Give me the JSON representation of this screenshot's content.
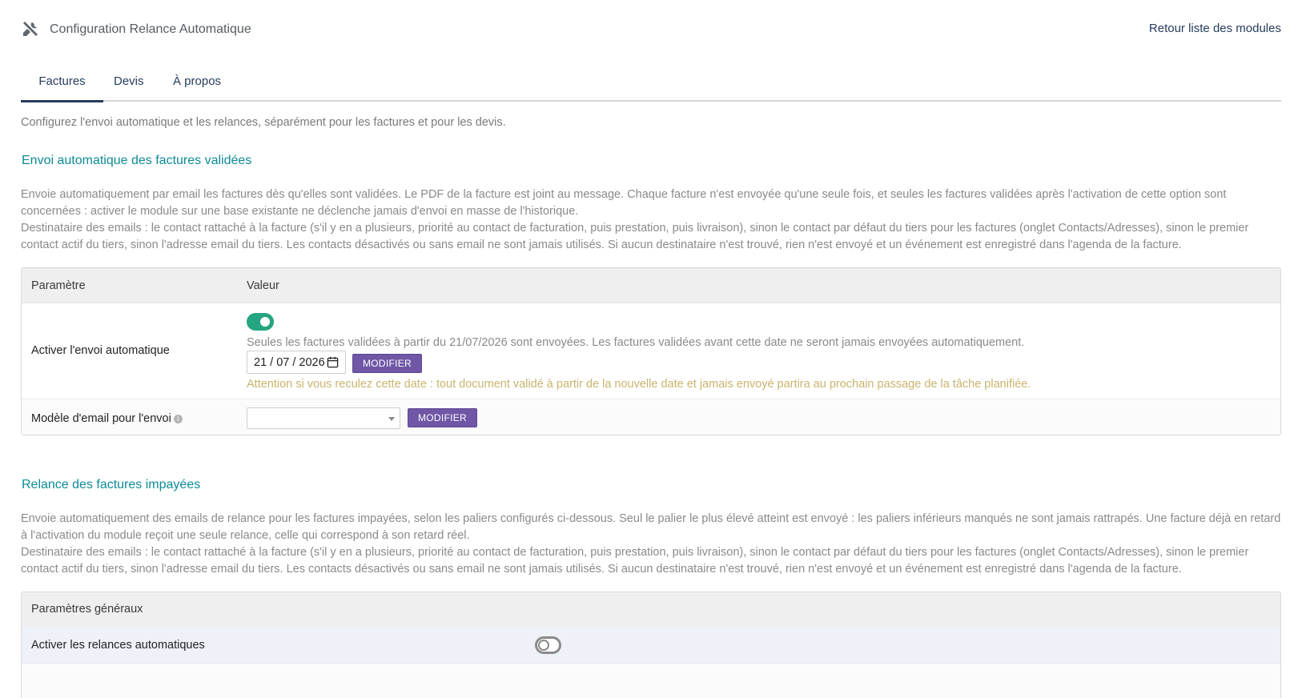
{
  "header": {
    "title": "Configuration Relance Automatique",
    "back_link": "Retour liste des modules"
  },
  "tabs": [
    {
      "label": "Factures",
      "active": true
    },
    {
      "label": "Devis",
      "active": false
    },
    {
      "label": "À propos",
      "active": false
    }
  ],
  "intro": "Configurez l'envoi automatique et les relances, séparément pour les factures et pour les devis.",
  "section_auto": {
    "title": "Envoi automatique des factures validées",
    "desc_1": "Envoie automatiquement par email les factures dès qu'elles sont validées. Le PDF de la facture est joint au message. Chaque facture n'est envoyée qu'une seule fois, et seules les factures validées après l'activation de cette option sont concernées : activer le module sur une base existante ne déclenche jamais d'envoi en masse de l'historique.",
    "desc_2": "Destinataire des emails : le contact rattaché à la facture (s'il y en a plusieurs, priorité au contact de facturation, puis prestation, puis livraison), sinon le contact par défaut du tiers pour les factures (onglet Contacts/Adresses), sinon le premier contact actif du tiers, sinon l'adresse email du tiers. Les contacts désactivés ou sans email ne sont jamais utilisés. Si aucun destinataire n'est trouvé, rien n'est envoyé et un événement est enregistré dans l'agenda de la facture.",
    "table": {
      "col_param": "Paramètre",
      "col_value": "Valeur",
      "row_auto": {
        "label": "Activer l'envoi automatique",
        "enabled": true,
        "note": "Seules les factures validées à partir du 21/07/2026 sont envoyées. Les factures validées avant cette date ne seront jamais envoyées automatiquement.",
        "date_value": "21 / 07 / 2026",
        "button": "MODIFIER",
        "warning": "Attention si vous reculez cette date : tout document validé à partir de la nouvelle date et jamais envoyé partira au prochain passage de la tâche planifiée."
      },
      "row_model": {
        "label": "Modèle d'email pour l'envoi",
        "info_icon": "i",
        "select_value": "",
        "button": "MODIFIER"
      }
    }
  },
  "section_relance": {
    "title": "Relance des factures impayées",
    "desc_1": "Envoie automatiquement des emails de relance pour les factures impayées, selon les paliers configurés ci-dessous. Seul le palier le plus élevé atteint est envoyé : les paliers inférieurs manqués ne sont jamais rattrapés. Une facture déjà en retard à l'activation du module reçoit une seule relance, celle qui correspond à son retard réel.",
    "desc_2": "Destinataire des emails : le contact rattaché à la facture (s'il y en a plusieurs, priorité au contact de facturation, puis prestation, puis livraison), sinon le contact par défaut du tiers pour les factures (onglet Contacts/Adresses), sinon le premier contact actif du tiers, sinon l'adresse email du tiers. Les contacts désactivés ou sans email ne sont jamais utilisés. Si aucun destinataire n'est trouvé, rien n'est envoyé et un événement est enregistré dans l'agenda de la facture.",
    "table": {
      "title": "Paramètres généraux",
      "row_enable": {
        "label": "Activer les relances automatiques",
        "enabled": false
      }
    }
  },
  "colors": {
    "accent": "#263c5c",
    "section_title": "#0d8b98",
    "toggle_on": "#25a580",
    "button": "#6f57a6",
    "warning": "#c9b46c"
  }
}
